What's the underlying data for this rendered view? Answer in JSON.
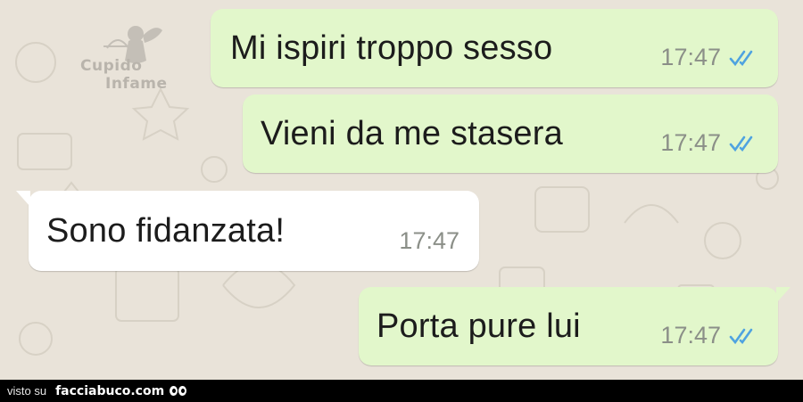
{
  "chat": {
    "wallpaper_color": "#e9e3d9",
    "outgoing_bubble_color": "#e2f7cb",
    "incoming_bubble_color": "#ffffff",
    "read_tick_color": "#4fa3e0",
    "messages": [
      {
        "direction": "outgoing",
        "text": "Mi ispiri troppo sesso",
        "time": "17:47",
        "status": "read",
        "icon": "double-check-icon"
      },
      {
        "direction": "outgoing",
        "text": "Vieni da me stasera",
        "time": "17:47",
        "status": "read",
        "icon": "double-check-icon"
      },
      {
        "direction": "incoming",
        "text": "Sono fidanzata!",
        "time": "17:47"
      },
      {
        "direction": "outgoing",
        "text": "Porta pure lui",
        "time": "17:47",
        "status": "read",
        "icon": "double-check-icon"
      }
    ]
  },
  "watermark": {
    "line1": "Cupido",
    "line2": "Infame",
    "icon": "cupid-icon"
  },
  "footer": {
    "prefix": "visto su",
    "site": "facciabuco.com",
    "icon": "eyes-icon"
  }
}
